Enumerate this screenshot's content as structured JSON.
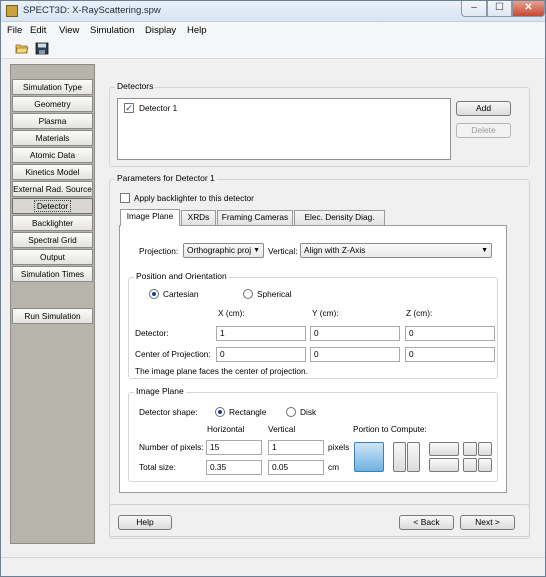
{
  "window": {
    "title": "SPECT3D:  X-RayScattering.spw",
    "minimize": "–",
    "maximize": "☐",
    "close": "✕"
  },
  "menu": [
    {
      "label": "File"
    },
    {
      "label": "Edit"
    },
    {
      "label": "View"
    },
    {
      "label": "Simulation"
    },
    {
      "label": "Display"
    },
    {
      "label": "Help"
    }
  ],
  "toolbar": {
    "open_icon": "open-folder-icon",
    "save_icon": "save-disk-icon"
  },
  "sidebar": {
    "items": [
      {
        "label": "Simulation Type"
      },
      {
        "label": "Geometry"
      },
      {
        "label": "Plasma"
      },
      {
        "label": "Materials"
      },
      {
        "label": "Atomic Data"
      },
      {
        "label": "Kinetics Model"
      },
      {
        "label": "External Rad. Source"
      },
      {
        "label": "Detector"
      },
      {
        "label": "Backlighter"
      },
      {
        "label": "Spectral Grid"
      },
      {
        "label": "Output"
      },
      {
        "label": "Simulation Times"
      }
    ],
    "active": "Detector",
    "run": "Run Simulation"
  },
  "detectors": {
    "title": "Detectors",
    "items": [
      {
        "label": "Detector 1",
        "checked": true
      }
    ],
    "add": "Add",
    "delete": "Delete"
  },
  "params": {
    "title": "Parameters for Detector 1",
    "backlighter_label": "Apply backlighter to this detector",
    "tabs": [
      {
        "label": "Image Plane"
      },
      {
        "label": "XRDs"
      },
      {
        "label": "Framing Cameras"
      },
      {
        "label": "Elec. Density Diag."
      }
    ],
    "active_tab": "Image Plane",
    "projection_label": "Projection:",
    "projection_value": "Orthographic proj",
    "vertical_label": "Vertical:",
    "vertical_value": "Align with Z-Axis",
    "pos_title": "Position and Orientation",
    "cartesian": "Cartesian",
    "spherical": "Spherical",
    "coord_mode": "Cartesian",
    "col_x": "X (cm):",
    "col_y": "Y (cm):",
    "col_z": "Z (cm):",
    "detector_label": "Detector:",
    "detector_x": "1",
    "detector_y": "0",
    "detector_z": "0",
    "center_label": "Center of Projection:",
    "center_x": "0",
    "center_y": "0",
    "center_z": "0",
    "note": "The image plane faces the center of projection.",
    "image_plane_title": "Image Plane",
    "shape_label": "Detector shape:",
    "rectangle": "Rectangle",
    "disk": "Disk",
    "shape_mode": "Rectangle",
    "horizontal": "Horizontal",
    "vertical": "Vertical",
    "pixels_label": "Number of pixels:",
    "pixels_h": "15",
    "pixels_v": "1",
    "pixels_unit": "pixels",
    "size_label": "Total size:",
    "size_h": "0.35",
    "size_v": "0.05",
    "size_unit": "cm",
    "portion_label": "Portion to Compute:",
    "selected_portion": "full"
  },
  "footer": {
    "help": "Help",
    "back": "< Back",
    "next": "Next >"
  }
}
